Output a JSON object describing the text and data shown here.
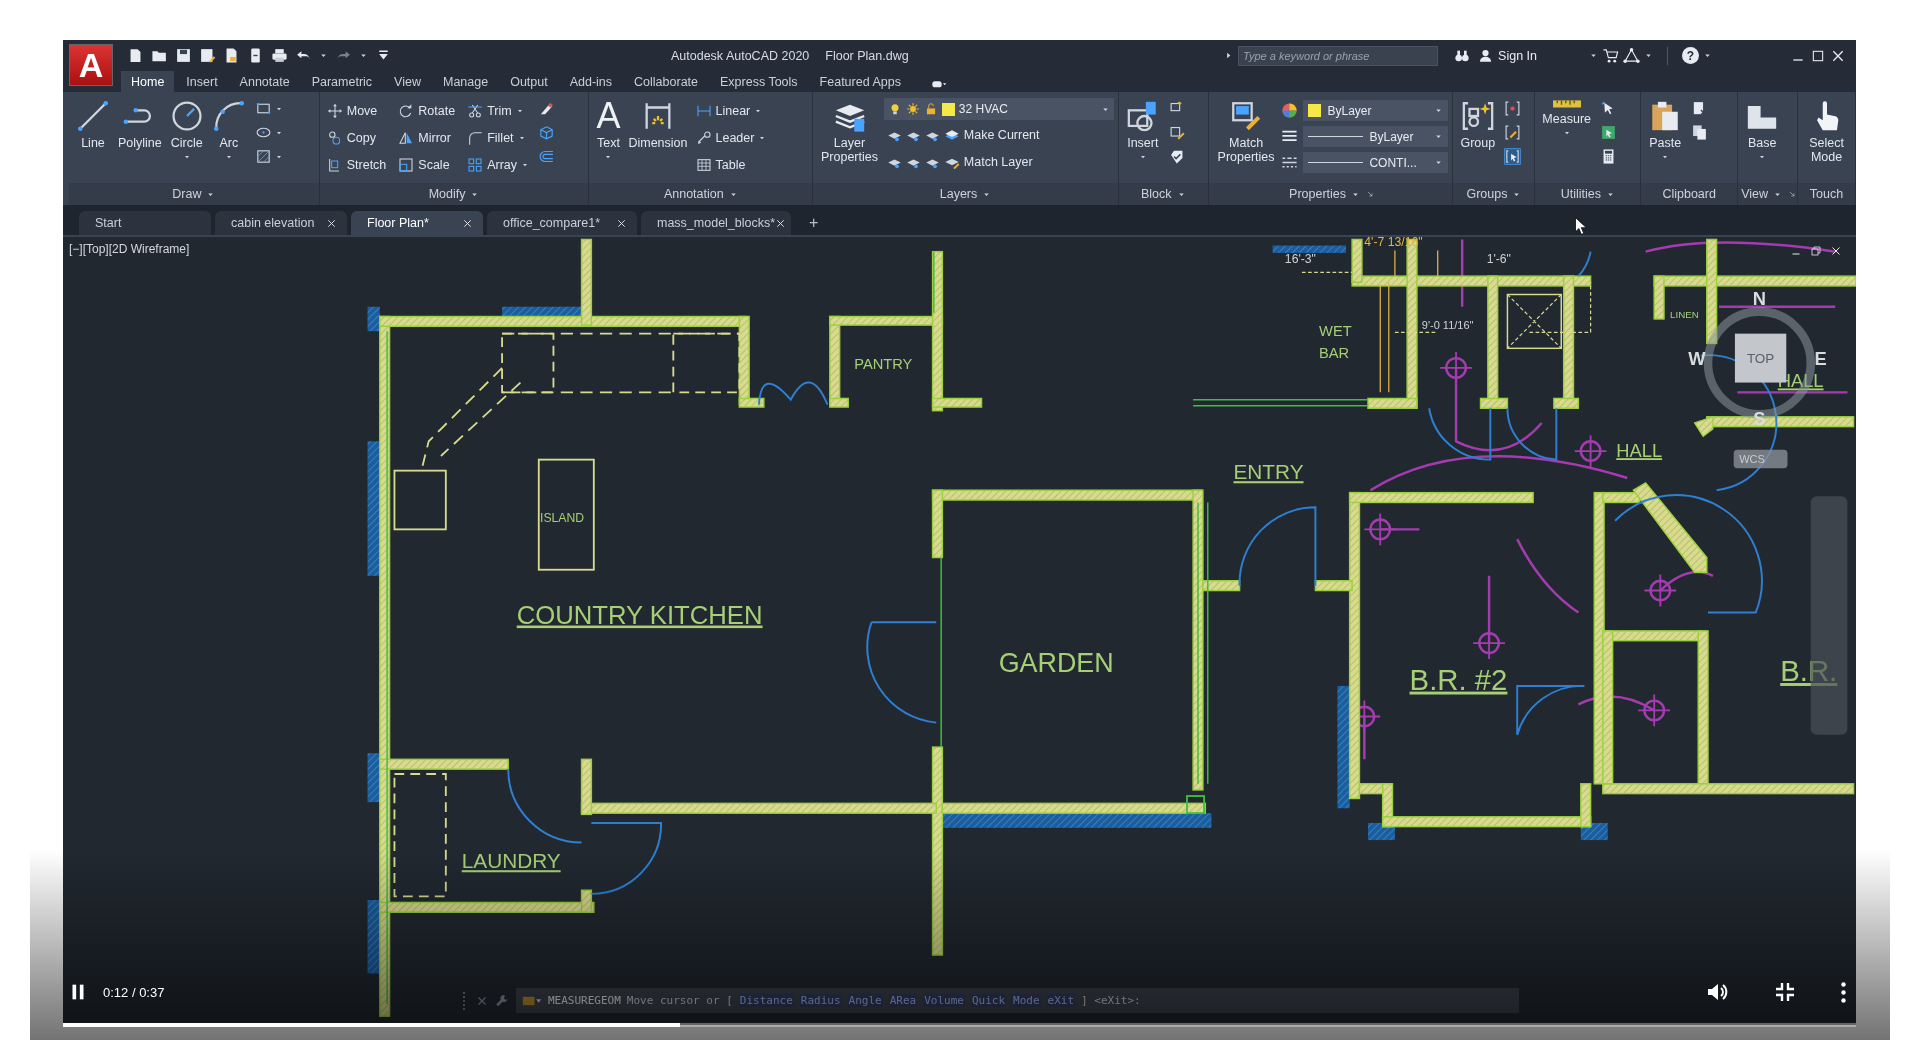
{
  "app": {
    "logo": "A",
    "title": "Autodesk AutoCAD 2020",
    "file": "Floor Plan.dwg",
    "help": "?"
  },
  "search": {
    "placeholder": "Type a keyword or phrase"
  },
  "sign_in": "Sign In",
  "tabs": [
    {
      "label": "Home",
      "selected": true
    },
    {
      "label": "Insert",
      "selected": false
    },
    {
      "label": "Annotate",
      "selected": false
    },
    {
      "label": "Parametric",
      "selected": false
    },
    {
      "label": "View",
      "selected": false
    },
    {
      "label": "Manage",
      "selected": false
    },
    {
      "label": "Output",
      "selected": false
    },
    {
      "label": "Add-ins",
      "selected": false
    },
    {
      "label": "Collaborate",
      "selected": false
    },
    {
      "label": "Express Tools",
      "selected": false
    },
    {
      "label": "Featured Apps",
      "selected": false
    }
  ],
  "panels": [
    {
      "title": "Draw",
      "menu": true,
      "tools": [
        {
          "label": "Line",
          "dropdown": false
        },
        {
          "label": "Polyline",
          "dropdown": false
        },
        {
          "label": "Circle",
          "dropdown": true
        },
        {
          "label": "Arc",
          "dropdown": true
        }
      ]
    },
    {
      "title": "Modify",
      "menu": true,
      "small_tools": [
        {
          "label": "Move",
          "dropdown": false
        },
        {
          "label": "Rotate",
          "dropdown": false
        },
        {
          "label": "Trim",
          "dropdown": true
        },
        {
          "label": "Copy",
          "dropdown": false
        },
        {
          "label": "Mirror",
          "dropdown": false
        },
        {
          "label": "Fillet",
          "dropdown": true
        },
        {
          "label": "Stretch",
          "dropdown": false
        },
        {
          "label": "Scale",
          "dropdown": false
        },
        {
          "label": "Array",
          "dropdown": true
        }
      ]
    },
    {
      "title": "Annotation",
      "menu": true,
      "tools": [
        {
          "label": "Text",
          "glyph": "A",
          "dropdown": true
        },
        {
          "label": "Dimension",
          "dropdown": false
        }
      ],
      "small_tools": [
        {
          "label": "Linear",
          "dropdown": true
        },
        {
          "label": "Leader",
          "dropdown": true
        },
        {
          "label": "Table",
          "dropdown": false
        }
      ]
    },
    {
      "title": "Layers",
      "menu": true,
      "tools": [
        {
          "label": "Layer Properties",
          "dropdown": false
        }
      ],
      "layer": "32 HVAC",
      "small_tools": [
        {
          "label": "Make Current",
          "dropdown": false
        },
        {
          "label": "Match Layer",
          "dropdown": false
        }
      ]
    },
    {
      "title": "Block",
      "menu": true,
      "tools": [
        {
          "label": "Insert",
          "dropdown": true
        }
      ]
    },
    {
      "title": "Properties",
      "menu": true,
      "launcher": true,
      "tools": [
        {
          "label": "Match Properties",
          "dropdown": false
        }
      ],
      "selects": [
        "ByLayer",
        "ByLayer",
        "CONTI..."
      ]
    },
    {
      "title": "Groups",
      "menu": true,
      "tools": [
        {
          "label": "Group",
          "dropdown": false
        }
      ]
    },
    {
      "title": "Utilities",
      "menu": true,
      "tools": [
        {
          "label": "Measure",
          "dropdown": true
        }
      ]
    },
    {
      "title": "Clipboard",
      "menu": false,
      "tools": [
        {
          "label": "Paste",
          "dropdown": true
        }
      ]
    },
    {
      "title": "View",
      "menu": true,
      "launcher": true,
      "tools": [
        {
          "label": "Base",
          "dropdown": true
        }
      ]
    },
    {
      "title": "Touch",
      "menu": false,
      "tools": [
        {
          "label": "Select Mode",
          "dropdown": false
        }
      ]
    }
  ],
  "doc_tabs": [
    {
      "label": "Start",
      "selected": false,
      "closable": false
    },
    {
      "label": "cabin elevation",
      "selected": false,
      "closable": true
    },
    {
      "label": "Floor Plan*",
      "selected": true,
      "closable": true
    },
    {
      "label": "office_compare1*",
      "selected": false,
      "closable": true
    },
    {
      "label": "mass_model_blocks*",
      "selected": false,
      "closable": true
    }
  ],
  "new_tab": "+",
  "viewport_label": "[−][Top][2D Wireframe]",
  "drawing_labels": [
    {
      "text": "4'-7 13/16\"",
      "kind": "highlighted-dimension",
      "underlined": false
    },
    {
      "text": "16'-3\"",
      "kind": "dimension",
      "underlined": false
    },
    {
      "text": "1'-6\"",
      "kind": "dimension",
      "underlined": false
    },
    {
      "text": "LINEN",
      "kind": "room",
      "underlined": false
    },
    {
      "text": "WET",
      "kind": "room",
      "underlined": false
    },
    {
      "text": "9'-0 11/16\"",
      "kind": "dimension",
      "underlined": false
    },
    {
      "text": "BAR",
      "kind": "room",
      "underlined": false
    },
    {
      "text": "PANTRY",
      "kind": "room",
      "underlined": false
    },
    {
      "text": "HALL",
      "kind": "room",
      "underlined": true
    },
    {
      "text": "HALL",
      "kind": "room",
      "underlined": true
    },
    {
      "text": "ENTRY",
      "kind": "room",
      "underlined": true
    },
    {
      "text": "ISLAND",
      "kind": "room",
      "underlined": false
    },
    {
      "text": "COUNTRY KITCHEN",
      "kind": "room",
      "underlined": true
    },
    {
      "text": "GARDEN",
      "kind": "room",
      "underlined": false
    },
    {
      "text": "B.R. #2",
      "kind": "room",
      "underlined": true
    },
    {
      "text": "B.R.",
      "kind": "room",
      "underlined": true
    },
    {
      "text": "LAUNDRY",
      "kind": "room",
      "underlined": true
    }
  ],
  "viewcube": {
    "north": "N",
    "west": "W",
    "top": "TOP",
    "east": "E",
    "south": "S",
    "wcs": "WCS"
  },
  "command_line": {
    "command": "MEASUREGEOM",
    "prompt": "Move cursor or [",
    "options": [
      "Distance",
      "Radius",
      "Angle",
      "ARea",
      "Volume",
      "Quick",
      "Mode",
      "eXit"
    ],
    "end": "] <eXit>:"
  },
  "player": {
    "playing": true,
    "time": "0:12 / 0:37",
    "level": 0.344
  }
}
